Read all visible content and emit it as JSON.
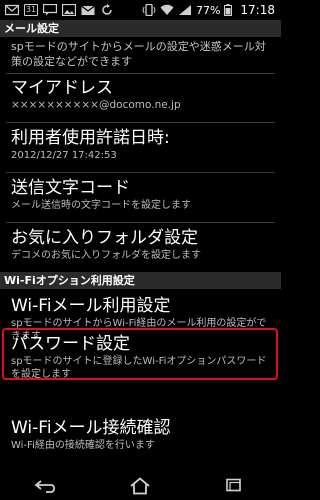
{
  "status_bar": {
    "notif_icons": [
      "gmail-icon",
      "calendar-icon",
      "message-icon",
      "image-icon",
      "email-icon",
      "sync-icon"
    ],
    "calendar_day": "31",
    "battery_percent": "77%",
    "time": "17:18"
  },
  "sections": [
    {
      "label": "メール設定"
    },
    {
      "label": "Wi-Fiオプション利用設定"
    }
  ],
  "items": [
    {
      "title": "",
      "summary": "spモードのサイトからメールの設定や迷惑メール対策の設定などができます"
    },
    {
      "title": "マイアドレス",
      "summary": "××××××××××@docomo.ne.jp"
    },
    {
      "title": "利用者使用許諾日時:",
      "summary": "2012/12/27 17:42:53"
    },
    {
      "title": "送信文字コード",
      "summary": "メール送信時の文字コードを設定します"
    },
    {
      "title": "お気に入りフォルダ設定",
      "summary": "デコメのお気に入りフォルダを設定します"
    },
    {
      "title": "Wi-Fiメール利用設定",
      "summary": "spモードのサイトからWi-Fi経由のメール利用の設定ができます"
    },
    {
      "title": "パスワード設定",
      "summary": "spモードのサイトに登録したWi-Fiオプションパスワードを設定します"
    },
    {
      "title": "Wi-Fiメール接続確認",
      "summary": "Wi-Fi経由の接続確認を行います"
    }
  ],
  "nav_bar": [
    "back-icon",
    "home-icon",
    "recent-apps-icon"
  ]
}
